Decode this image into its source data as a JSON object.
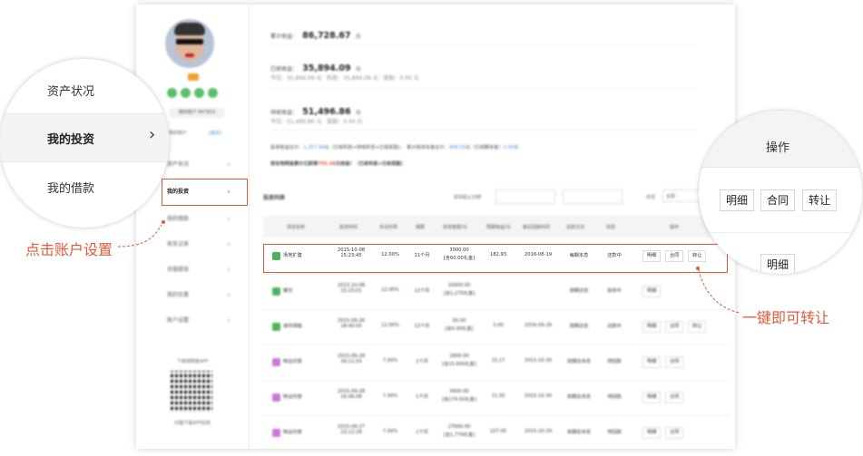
{
  "sidebar": {
    "username": "我的账户 847853",
    "small_links": [
      "我的账户",
      "[退出]"
    ],
    "items": [
      {
        "label": "资产状况"
      },
      {
        "label": "我的投资"
      },
      {
        "label": "我的借款"
      },
      {
        "label": "收支记录"
      },
      {
        "label": "充值提现"
      },
      {
        "label": "我的优惠"
      },
      {
        "label": "账户设置"
      }
    ],
    "app_title": "下载地网金APP",
    "app_sub": "扫描下载APP应用"
  },
  "summary": {
    "total_label": "累计收益：",
    "total_value": "86,728.67",
    "total_unit": "元",
    "earned_label": "已收收益：",
    "earned_value": "35,894.09",
    "earned_unit": "元",
    "earned_detail": "今日：35,894.09 元  ·  利息：35,894.09 元  ·  奖励：0.00 元",
    "pending_label": "待收收益：",
    "pending_value": "51,496.86",
    "pending_unit": "元",
    "pending_detail": "今日：51,496.86 元  ·  奖励：0.00 元",
    "line1_a": "投资收益合计：",
    "line1_v1": "1,257.94",
    "line1_b": "元（已收利息+待收利息+已收奖励）， 累计投资本金合计：",
    "line1_v2": "408.55",
    "line1_c": "元（已到期本金）",
    "line1_v3": "0.00",
    "line1_d": "元",
    "line2_a": "您在地网金累计已获得",
    "line2_v": "705.58",
    "line2_b": "元收益！（已收利息+已收奖励）"
  },
  "list": {
    "title": "投资列表",
    "date_filter_label": "投资起止日期",
    "status_filter_label": "状态",
    "status_filter_value": "全部",
    "headers": [
      "项目名称",
      "投资时间",
      "年化利率",
      "期限",
      "投资金额/元",
      "预期收益/元",
      "最近回款时间",
      "还款方式",
      "状态",
      "操作"
    ],
    "rows": [
      {
        "name": "场地扩建",
        "time": "2015-10-08 15:23:45",
        "rate": "12.00%",
        "term": "11个月",
        "amount": "3000.00",
        "amount2": "[含60.00礼金]",
        "expect": "182.93",
        "date": "2016-08-19",
        "method": "每期本息",
        "status": "还款中",
        "actions": [
          "明细",
          "合同",
          "转让"
        ],
        "color": "green"
      },
      {
        "name": "餐饮",
        "time": "2015-10-08 15:23:01",
        "rate": "12.00%",
        "term": "12个月",
        "amount": "10000.00",
        "amount2": "[含1,275礼金]",
        "expect": "",
        "date": "",
        "method": "按期还息",
        "status": "投资中",
        "actions": [
          "明细"
        ],
        "color": "green"
      },
      {
        "name": "城市绿植",
        "time": "2015-09-26 18:40:05",
        "rate": "12.00%",
        "term": "12个月",
        "amount": "50.00",
        "amount2": "[含0.00礼金]",
        "expect": "3.00",
        "date": "2016-09-26",
        "method": "按期还息",
        "status": "还款中",
        "actions": [
          "明细",
          "合同",
          "转让"
        ],
        "color": "green"
      },
      {
        "name": "物业托管",
        "time": "2015-09-28 16:11:54",
        "rate": "7.00%",
        "term": "1个月",
        "amount": "2600.00",
        "amount2": "[含15.600礼金]",
        "expect": "15.17",
        "date": "2015-10-30",
        "method": "到期还本息",
        "status": "待回款",
        "actions": [
          "明细",
          "合同"
        ],
        "color": "purple"
      },
      {
        "name": "物业托管",
        "time": "2015-09-28 16:06:08",
        "rate": "7.00%",
        "term": "1个月",
        "amount": "3600.00",
        "amount2": "[含179.50礼金]",
        "expect": "21.00",
        "date": "2015-10-30",
        "method": "到期还本息",
        "status": "待回款",
        "actions": [
          "明细",
          "合同"
        ],
        "color": "purple"
      },
      {
        "name": "物业托管",
        "time": "2015-09-27 23:12:28",
        "rate": "7.00%",
        "term": "1个月",
        "amount": "27600.00",
        "amount2": "[含1,779礼金]",
        "expect": "157.00",
        "date": "2015-10-29",
        "method": "到期还本息",
        "status": "待回款",
        "actions": [
          "明细",
          "合同"
        ],
        "color": "purple"
      }
    ]
  },
  "left_zoom": {
    "items": [
      "资产状况",
      "我的投资",
      "我的借款"
    ]
  },
  "right_zoom": {
    "header": "操作",
    "buttons": [
      "明细",
      "合同",
      "转让"
    ],
    "bottom_button": "明细"
  },
  "annotations": {
    "left": "点击账户设置",
    "right": "一键即可转让"
  },
  "colors": {
    "accent": "#e05a3a",
    "green_icon": "#4cb35c",
    "purple_icon": "#c979d6",
    "link_blue": "#3a8de0"
  }
}
